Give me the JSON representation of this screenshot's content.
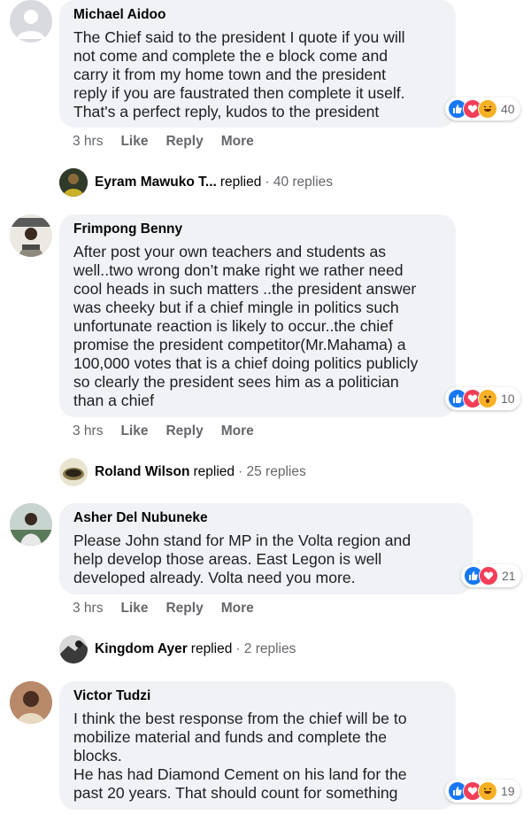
{
  "comments": [
    {
      "author": "Michael Aidoo",
      "text": "The Chief said to the president I quote if you will\nnot come and complete the e block come and\ncarry it from my home town and the president\nreply if you are faustrated then complete it uself.\nThat's a perfect reply, kudos to the president",
      "reaction_count": "40",
      "time": "3 hrs",
      "like": "Like",
      "reply": "Reply",
      "more": "More",
      "replies": {
        "name": "Eyram Mawuko T...",
        "word": "replied",
        "count": "· 40 replies"
      }
    },
    {
      "author": "Frimpong Benny",
      "text": "After post your own teachers and students as\nwell..two wrong don’t make right we rather need\ncool heads in such matters ..the president answer\nwas cheeky but if a chief mingle in politics such\nunfortunate reaction is likely to occur..the chief\npromise the president competitor(Mr.Mahama) a\n100,000 votes that is a chief doing politics publicly\nso clearly the president sees him as a politician\nthan a chief",
      "reaction_count": "10",
      "time": "3 hrs",
      "like": "Like",
      "reply": "Reply",
      "more": "More",
      "replies": {
        "name": "Roland Wilson",
        "word": "replied",
        "count": "· 25 replies"
      }
    },
    {
      "author": "Asher Del Nubuneke",
      "text": "Please John stand for MP in the Volta region and\nhelp develop those areas. East Legon is well\ndeveloped already. Volta need you more.",
      "reaction_count": "21",
      "time": "3 hrs",
      "like": "Like",
      "reply": "Reply",
      "more": "More",
      "replies": {
        "name": "Kingdom Ayer",
        "word": "replied",
        "count": "· 2 replies"
      }
    },
    {
      "author": "Victor Tudzi",
      "text": "I think the best response from the chief will be to\nmobilize material and funds and complete the\nblocks.\nHe has had Diamond Cement on his land for the\npast 20 years. That should count for something",
      "reaction_count": "19"
    }
  ],
  "colors": {
    "like": "#1877f2",
    "love": "#f33e58",
    "haha": "#f7b125",
    "bubble": "#f0f2f5"
  },
  "icons": [
    "like-reaction-icon",
    "love-reaction-icon",
    "haha-reaction-icon",
    "wow-reaction-icon"
  ]
}
